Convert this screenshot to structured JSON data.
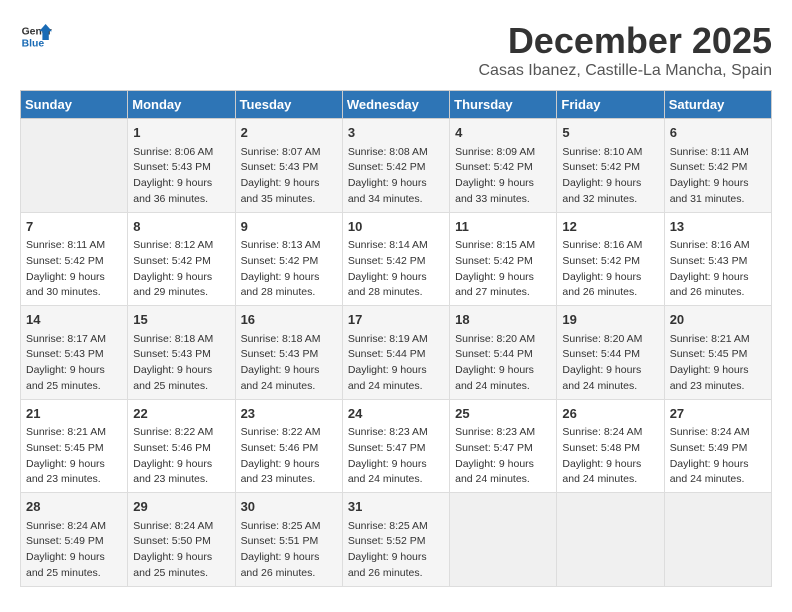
{
  "logo": {
    "line1": "General",
    "line2": "Blue"
  },
  "title": "December 2025",
  "subtitle": "Casas Ibanez, Castille-La Mancha, Spain",
  "days_of_week": [
    "Sunday",
    "Monday",
    "Tuesday",
    "Wednesday",
    "Thursday",
    "Friday",
    "Saturday"
  ],
  "weeks": [
    [
      {
        "day": "",
        "info": ""
      },
      {
        "day": "1",
        "info": "Sunrise: 8:06 AM\nSunset: 5:43 PM\nDaylight: 9 hours\nand 36 minutes."
      },
      {
        "day": "2",
        "info": "Sunrise: 8:07 AM\nSunset: 5:43 PM\nDaylight: 9 hours\nand 35 minutes."
      },
      {
        "day": "3",
        "info": "Sunrise: 8:08 AM\nSunset: 5:42 PM\nDaylight: 9 hours\nand 34 minutes."
      },
      {
        "day": "4",
        "info": "Sunrise: 8:09 AM\nSunset: 5:42 PM\nDaylight: 9 hours\nand 33 minutes."
      },
      {
        "day": "5",
        "info": "Sunrise: 8:10 AM\nSunset: 5:42 PM\nDaylight: 9 hours\nand 32 minutes."
      },
      {
        "day": "6",
        "info": "Sunrise: 8:11 AM\nSunset: 5:42 PM\nDaylight: 9 hours\nand 31 minutes."
      }
    ],
    [
      {
        "day": "7",
        "info": "Sunrise: 8:11 AM\nSunset: 5:42 PM\nDaylight: 9 hours\nand 30 minutes."
      },
      {
        "day": "8",
        "info": "Sunrise: 8:12 AM\nSunset: 5:42 PM\nDaylight: 9 hours\nand 29 minutes."
      },
      {
        "day": "9",
        "info": "Sunrise: 8:13 AM\nSunset: 5:42 PM\nDaylight: 9 hours\nand 28 minutes."
      },
      {
        "day": "10",
        "info": "Sunrise: 8:14 AM\nSunset: 5:42 PM\nDaylight: 9 hours\nand 28 minutes."
      },
      {
        "day": "11",
        "info": "Sunrise: 8:15 AM\nSunset: 5:42 PM\nDaylight: 9 hours\nand 27 minutes."
      },
      {
        "day": "12",
        "info": "Sunrise: 8:16 AM\nSunset: 5:42 PM\nDaylight: 9 hours\nand 26 minutes."
      },
      {
        "day": "13",
        "info": "Sunrise: 8:16 AM\nSunset: 5:43 PM\nDaylight: 9 hours\nand 26 minutes."
      }
    ],
    [
      {
        "day": "14",
        "info": "Sunrise: 8:17 AM\nSunset: 5:43 PM\nDaylight: 9 hours\nand 25 minutes."
      },
      {
        "day": "15",
        "info": "Sunrise: 8:18 AM\nSunset: 5:43 PM\nDaylight: 9 hours\nand 25 minutes."
      },
      {
        "day": "16",
        "info": "Sunrise: 8:18 AM\nSunset: 5:43 PM\nDaylight: 9 hours\nand 24 minutes."
      },
      {
        "day": "17",
        "info": "Sunrise: 8:19 AM\nSunset: 5:44 PM\nDaylight: 9 hours\nand 24 minutes."
      },
      {
        "day": "18",
        "info": "Sunrise: 8:20 AM\nSunset: 5:44 PM\nDaylight: 9 hours\nand 24 minutes."
      },
      {
        "day": "19",
        "info": "Sunrise: 8:20 AM\nSunset: 5:44 PM\nDaylight: 9 hours\nand 24 minutes."
      },
      {
        "day": "20",
        "info": "Sunrise: 8:21 AM\nSunset: 5:45 PM\nDaylight: 9 hours\nand 23 minutes."
      }
    ],
    [
      {
        "day": "21",
        "info": "Sunrise: 8:21 AM\nSunset: 5:45 PM\nDaylight: 9 hours\nand 23 minutes."
      },
      {
        "day": "22",
        "info": "Sunrise: 8:22 AM\nSunset: 5:46 PM\nDaylight: 9 hours\nand 23 minutes."
      },
      {
        "day": "23",
        "info": "Sunrise: 8:22 AM\nSunset: 5:46 PM\nDaylight: 9 hours\nand 23 minutes."
      },
      {
        "day": "24",
        "info": "Sunrise: 8:23 AM\nSunset: 5:47 PM\nDaylight: 9 hours\nand 24 minutes."
      },
      {
        "day": "25",
        "info": "Sunrise: 8:23 AM\nSunset: 5:47 PM\nDaylight: 9 hours\nand 24 minutes."
      },
      {
        "day": "26",
        "info": "Sunrise: 8:24 AM\nSunset: 5:48 PM\nDaylight: 9 hours\nand 24 minutes."
      },
      {
        "day": "27",
        "info": "Sunrise: 8:24 AM\nSunset: 5:49 PM\nDaylight: 9 hours\nand 24 minutes."
      }
    ],
    [
      {
        "day": "28",
        "info": "Sunrise: 8:24 AM\nSunset: 5:49 PM\nDaylight: 9 hours\nand 25 minutes."
      },
      {
        "day": "29",
        "info": "Sunrise: 8:24 AM\nSunset: 5:50 PM\nDaylight: 9 hours\nand 25 minutes."
      },
      {
        "day": "30",
        "info": "Sunrise: 8:25 AM\nSunset: 5:51 PM\nDaylight: 9 hours\nand 26 minutes."
      },
      {
        "day": "31",
        "info": "Sunrise: 8:25 AM\nSunset: 5:52 PM\nDaylight: 9 hours\nand 26 minutes."
      },
      {
        "day": "",
        "info": ""
      },
      {
        "day": "",
        "info": ""
      },
      {
        "day": "",
        "info": ""
      }
    ]
  ]
}
